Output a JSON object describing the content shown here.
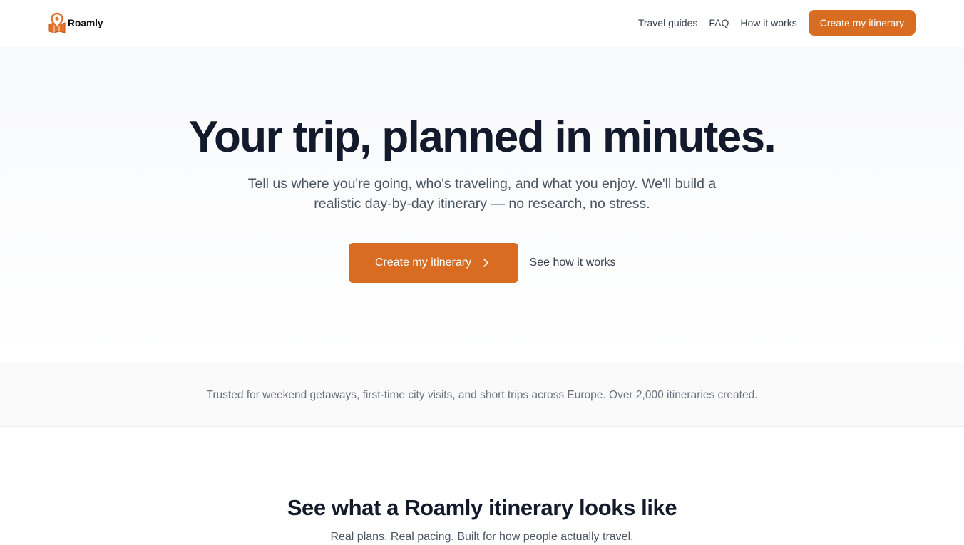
{
  "brand": {
    "name": "Roamly",
    "icon": "map-pin-icon",
    "accent_color": "#d86d21"
  },
  "header": {
    "nav": [
      {
        "label": "Travel guides"
      },
      {
        "label": "FAQ"
      },
      {
        "label": "How it works"
      }
    ],
    "cta_label": "Create my itinerary"
  },
  "hero": {
    "title": "Your trip, planned in minutes.",
    "subtitle": "Tell us where you're going, who's traveling, and what you enjoy. We'll build a realistic day-by-day itinerary — no research, no stress.",
    "primary_cta": "Create my itinerary",
    "primary_cta_icon": "chevron-right-icon",
    "secondary_cta": "See how it works"
  },
  "trust": {
    "text": "Trusted for weekend getaways, first-time city visits, and short trips across Europe. Over 2,000 itineraries created."
  },
  "example": {
    "title": "See what a Roamly itinerary looks like",
    "subtitle": "Real plans. Real pacing. Built for how people actually travel."
  }
}
